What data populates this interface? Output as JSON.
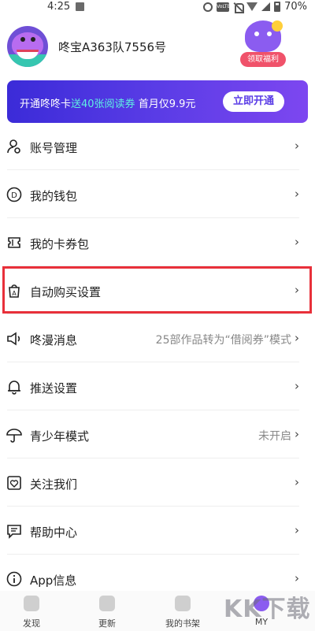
{
  "status_bar": {
    "time": "4:25",
    "battery": "70%",
    "network": "4G",
    "icons": [
      "image-icon",
      "alarm-icon",
      "volte-icon",
      "mute-icon",
      "wifi-icon",
      "signal-icon",
      "battery-icon"
    ]
  },
  "profile": {
    "username": "咚宝A363队7556号",
    "welfare_label": "领取福利"
  },
  "banner": {
    "text_prefix": "开通咚咚卡",
    "text_highlight": "送40张阅读券",
    "text_suffix": "首月仅9.9元",
    "button": "立即开通"
  },
  "menu": {
    "items": [
      {
        "label": "账号管理",
        "value": "",
        "icon": "user-icon"
      },
      {
        "label": "我的钱包",
        "value": "",
        "icon": "wallet-icon"
      },
      {
        "label": "我的卡券包",
        "value": "",
        "icon": "ticket-icon"
      },
      {
        "label": "自动购买设置",
        "value": "",
        "icon": "auto-buy-icon"
      },
      {
        "label": "咚漫消息",
        "value": "25部作品转为“借阅券”模式",
        "icon": "speaker-icon"
      },
      {
        "label": "推送设置",
        "value": "",
        "icon": "bell-icon"
      },
      {
        "label": "青少年模式",
        "value": "未开启",
        "icon": "umbrella-icon"
      },
      {
        "label": "关注我们",
        "value": "",
        "icon": "heart-icon"
      },
      {
        "label": "帮助中心",
        "value": "",
        "icon": "chat-icon"
      },
      {
        "label": "App信息",
        "value": "",
        "icon": "info-icon"
      }
    ]
  },
  "tabbar": {
    "tabs": [
      {
        "label": "发现",
        "icon": "discover-icon"
      },
      {
        "label": "更新",
        "icon": "calendar-icon"
      },
      {
        "label": "我的书架",
        "icon": "bookshelf-icon"
      },
      {
        "label": "MY",
        "icon": "my-icon"
      }
    ],
    "active": "MY"
  },
  "watermark": "KK下载",
  "colors": {
    "accent": "#5a3ce6",
    "highlight_border": "#e8303a",
    "banner_highlight": "#5ff0e2"
  }
}
